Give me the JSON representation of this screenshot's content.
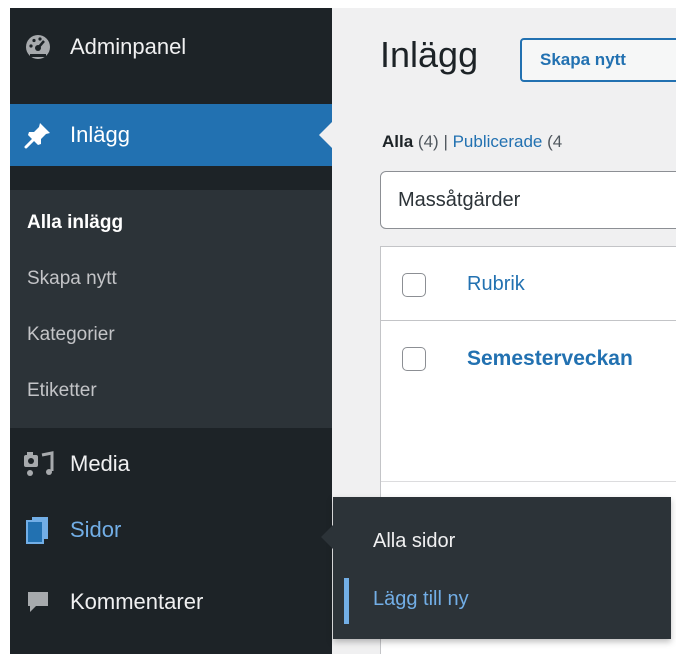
{
  "sidebar": {
    "items": [
      {
        "label": "Adminpanel",
        "icon": "dashboard-icon"
      },
      {
        "label": "Inlägg",
        "icon": "pin-icon"
      },
      {
        "label": "Media",
        "icon": "media-icon"
      },
      {
        "label": "Sidor",
        "icon": "pages-icon"
      },
      {
        "label": "Kommentarer",
        "icon": "comments-icon"
      }
    ],
    "submenu": [
      "Alla inlägg",
      "Skapa nytt",
      "Kategorier",
      "Etiketter"
    ]
  },
  "main": {
    "title": "Inlägg",
    "add_new": "Skapa nytt",
    "filters": {
      "all": "Alla",
      "all_count": "(4)",
      "separator": "|",
      "published": "Publicerade",
      "published_count": "(4"
    },
    "bulk_actions": "Massåtgärder",
    "table": {
      "header": "Rubrik",
      "rows": [
        "Semesterveckan"
      ]
    }
  },
  "flyout": {
    "items": [
      "Alla sidor",
      "Lägg till ny"
    ]
  },
  "colors": {
    "sidebar": "#1d2327",
    "submenu": "#2c3338",
    "accent": "#2271b1",
    "hover": "#72aee6"
  }
}
